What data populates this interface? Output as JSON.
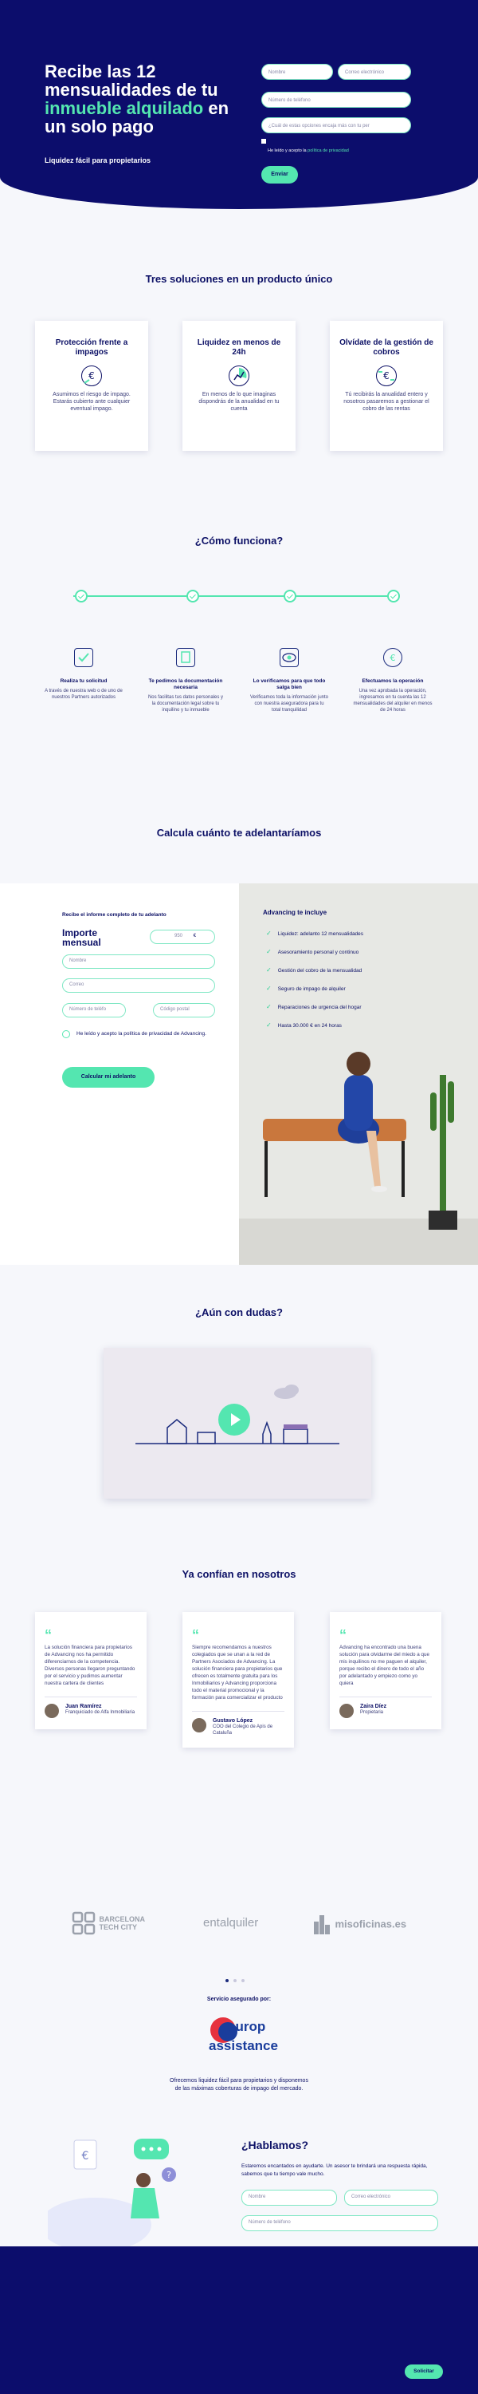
{
  "hero": {
    "title_pre": "Recibe las 12 mensualidades de tu ",
    "title_accent": "inmueble alquilado",
    "title_post": " en un solo pago",
    "subtitle": "Liquidez fácil para propietarios",
    "form": {
      "name_placeholder": "Nombre",
      "email_placeholder": "Correo electrónico",
      "phone_placeholder": "Número de teléfono",
      "question_placeholder": "¿Cuál de estas opciones encaja más con tu per",
      "privacy_prefix": "He leído y acepto la ",
      "privacy_link": "política de privacidad",
      "submit": "Enviar"
    }
  },
  "solutions": {
    "heading": "Tres soluciones en un producto único",
    "cards": [
      {
        "title": "Protección frente a impagos",
        "text": "Asumimos el riesgo de impago. Estarás cubierto ante cualquier eventual impago.",
        "icon": "euro-shield-icon"
      },
      {
        "title": "Liquidez en menos de 24h",
        "text": "En menos de lo que imaginas dispondrás de la anualidad en tu cuenta",
        "icon": "clock-chart-icon"
      },
      {
        "title": "Olvídate de la gestión de cobros",
        "text": "Tú recibirás la anualidad entero y nosotros pasaremos a gestionar el cobro de las rentas",
        "icon": "euro-transfer-icon"
      }
    ]
  },
  "how": {
    "heading": "¿Cómo funciona?",
    "steps": [
      {
        "title": "Realiza tu solicitud",
        "text": "A través de nuestra web o de uno de nuestros Partners autorizados",
        "icon": "checklist-icon"
      },
      {
        "title": "Te pedimos la documentación necesaria",
        "text": "Nos facilitas tus datos personales y la documentación legal sobre tu inquilino y tu inmueble",
        "icon": "documents-icon"
      },
      {
        "title": "Lo verificamos para que todo salga bien",
        "text": "Verificamos toda la información junto con nuestra aseguradora para tu total tranquilidad",
        "icon": "eye-scan-icon"
      },
      {
        "title": "Efectuamos la operación",
        "text": "Una vez aprobada la operación, ingresamos en tu cuenta las 12 mensualidades del alquiler en menos de 24 horas",
        "icon": "euro-cycle-icon"
      }
    ]
  },
  "calculator": {
    "heading": "Calcula cuánto te adelantaríamos",
    "intro": "Recibe el informe completo de tu adelanto",
    "amount_label": "Importe mensual",
    "amount_value": "950",
    "currency": "€",
    "name_placeholder": "Nombre",
    "email_placeholder": "Correo",
    "phone_placeholder": "Número de teléfo",
    "postal_placeholder": "Código postal",
    "privacy": "He leído y acepto la política de privacidad de Advancing.",
    "submit": "Calcular mi adelanto",
    "includes_title": "Advancing te incluye",
    "includes": [
      "Liquidez: adelanto 12 mensualidades",
      "Asesoramiento personal y continuo",
      "Gestión del cobro de la mensualidad",
      "Seguro de impago de alquiler",
      "Reparaciones de urgencia del hogar",
      "Hasta 30.000 € en 24 horas"
    ]
  },
  "doubts": {
    "heading": "¿Aún con dudas?"
  },
  "trust": {
    "heading": "Ya confían en nosotros",
    "testimonials": [
      {
        "text": "La solución financiera para propietarios de Advancing nos ha permitido diferenciarnos de la competencia. Diversos personas llegaron preguntando por el servicio y pudimos aumentar nuestra cartera de clientes",
        "name": "Juan Ramírez",
        "role": "Franquiciado de Alfa Inmobiliaria"
      },
      {
        "text": "Siempre recomendamos a nuestros colegiados que se unan a la red de Partners Asociados de Advancing. La solución financiera para propietarios que ofrecen es totalmente gratuita para los Inmobiliarios y Advancing proporciona todo el material promocional y la formación para comercializar el producto",
        "name": "Gustavo López",
        "role": "COO del Colegio de Apis de Cataluña"
      },
      {
        "text": "Advancing ha encontrado una buena solución para olvidarme del miedo a que mis inquilinos no me paguen el alquiler, porque recibo el dinero de todo el año por adelantado y empiezo como yo quiera",
        "name": "Zaira Díez",
        "role": "Propietaria"
      }
    ],
    "logos": [
      "BARCELONA TECH CITY",
      "entalquiler",
      "misoficinas.es"
    ]
  },
  "insurer": {
    "label": "Servicio asegurado por:",
    "brand_top": "europ",
    "brand_bottom": "assistance",
    "text": "Ofrecemos liquidez fácil para propietarios y disponemos de las máximas coberturas de impago del mercado."
  },
  "contact": {
    "heading": "¿Hablamos?",
    "text": "Estaremos encantados en ayudarte. Un asesor te brindará una respuesta rápida, sabemos que tu tiempo vale mucho.",
    "name_placeholder": "Nombre",
    "email_placeholder": "Correo electrónico",
    "phone_placeholder": "Número de teléfono",
    "submit": "Solicitar"
  },
  "colors": {
    "navy": "#0c0d6c",
    "mint": "#54e6b0",
    "background": "#f6f7fb"
  }
}
